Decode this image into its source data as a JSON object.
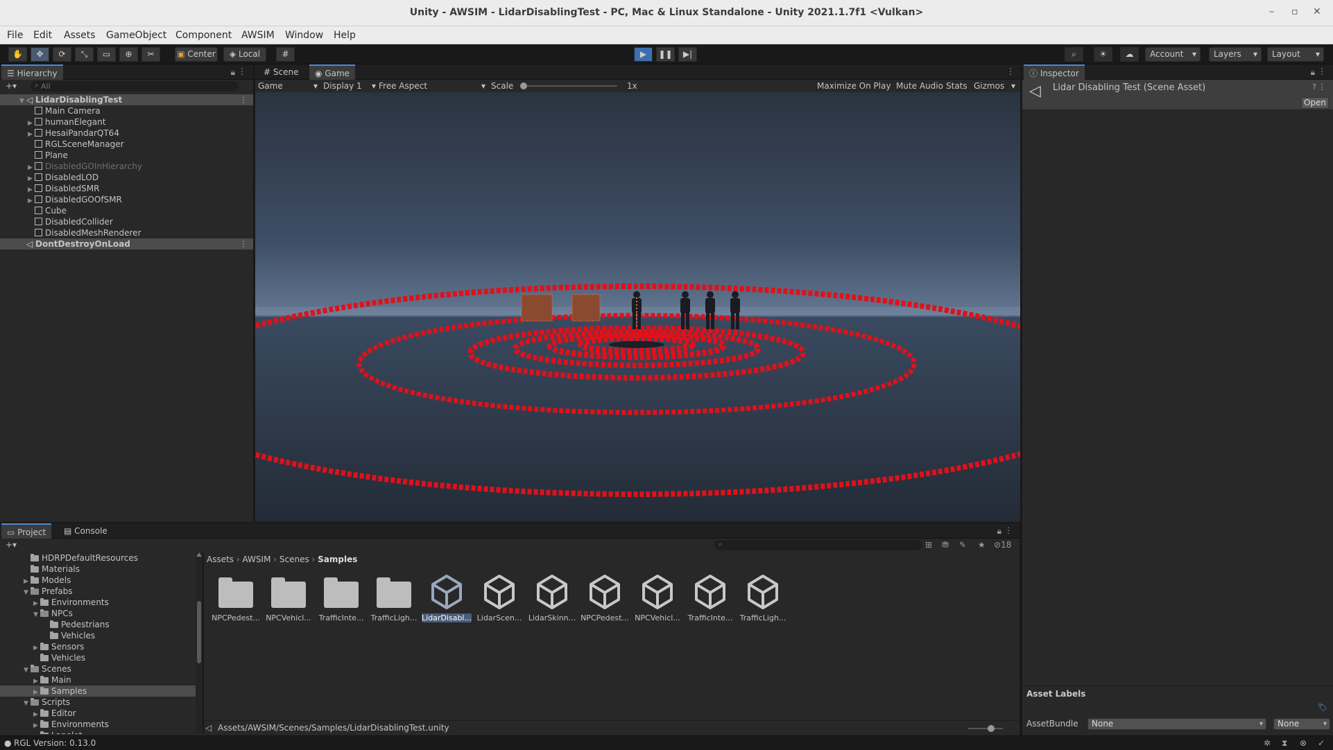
{
  "window": {
    "title": "Unity - AWSIM - LidarDisablingTest - PC, Mac & Linux Standalone - Unity 2021.1.7f1 <Vulkan>",
    "controls": [
      "–",
      "▫",
      "✕"
    ]
  },
  "menu": [
    "File",
    "Edit",
    "Assets",
    "GameObject",
    "Component",
    "AWSIM",
    "Window",
    "Help"
  ],
  "toolbar": {
    "pivot": "Center",
    "space": "Local",
    "account": "Account",
    "layers": "Layers",
    "layout": "Layout"
  },
  "hierarchy": {
    "tab": "Hierarchy",
    "search_placeholder": "All",
    "items": [
      {
        "label": "LidarDisablingTest",
        "depth": 0,
        "expanded": true,
        "kind": "scene",
        "selected": true
      },
      {
        "label": "Main Camera",
        "depth": 1,
        "kind": "go"
      },
      {
        "label": "humanElegant",
        "depth": 1,
        "kind": "go",
        "children": true
      },
      {
        "label": "HesaiPandarQT64",
        "depth": 1,
        "kind": "go",
        "children": true
      },
      {
        "label": "RGLSceneManager",
        "depth": 1,
        "kind": "go"
      },
      {
        "label": "Plane",
        "depth": 1,
        "kind": "go"
      },
      {
        "label": "DisabledGOInHierarchy",
        "depth": 1,
        "kind": "go",
        "children": true,
        "disabled": true
      },
      {
        "label": "DisabledLOD",
        "depth": 1,
        "kind": "go",
        "children": true
      },
      {
        "label": "DisabledSMR",
        "depth": 1,
        "kind": "go",
        "children": true
      },
      {
        "label": "DisabledGOOfSMR",
        "depth": 1,
        "kind": "go",
        "children": true
      },
      {
        "label": "Cube",
        "depth": 1,
        "kind": "go"
      },
      {
        "label": "DisabledCollider",
        "depth": 1,
        "kind": "go"
      },
      {
        "label": "DisabledMeshRenderer",
        "depth": 1,
        "kind": "go"
      },
      {
        "label": "DontDestroyOnLoad",
        "depth": 0,
        "kind": "scene",
        "selected": true
      }
    ]
  },
  "view_tabs": {
    "scene": "Scene",
    "game": "Game"
  },
  "game_toolbar": {
    "mode": "Game",
    "display": "Display 1",
    "aspect": "Free Aspect",
    "scale_label": "Scale",
    "scale_value": "1x",
    "scale_level": 0.0,
    "maximize": "Maximize On Play",
    "mute": "Mute Audio",
    "stats": "Stats",
    "gizmos": "Gizmos"
  },
  "inspector": {
    "tab": "Inspector",
    "title": "Lidar Disabling Test (Scene Asset)",
    "open_button": "Open",
    "asset_labels": "Asset Labels",
    "assetbundle_label": "AssetBundle",
    "assetbundle_value": "None",
    "variant_value": "None"
  },
  "bottom_tabs": {
    "project": "Project",
    "console": "Console"
  },
  "project": {
    "hidden_count": "18",
    "tree": [
      {
        "label": "HDRPDefaultResources",
        "depth": 1
      },
      {
        "label": "Materials",
        "depth": 1
      },
      {
        "label": "Models",
        "depth": 1,
        "children": true
      },
      {
        "label": "Prefabs",
        "depth": 1,
        "expanded": true
      },
      {
        "label": "Environments",
        "depth": 2,
        "children": true
      },
      {
        "label": "NPCs",
        "depth": 2,
        "expanded": true
      },
      {
        "label": "Pedestrians",
        "depth": 3
      },
      {
        "label": "Vehicles",
        "depth": 3
      },
      {
        "label": "Sensors",
        "depth": 2,
        "children": true
      },
      {
        "label": "Vehicles",
        "depth": 2
      },
      {
        "label": "Scenes",
        "depth": 1,
        "expanded": true
      },
      {
        "label": "Main",
        "depth": 2,
        "children": true
      },
      {
        "label": "Samples",
        "depth": 2,
        "children": true,
        "selected": true
      },
      {
        "label": "Scripts",
        "depth": 1,
        "expanded": true
      },
      {
        "label": "Editor",
        "depth": 2,
        "children": true
      },
      {
        "label": "Environments",
        "depth": 2,
        "children": true
      },
      {
        "label": "Lanelet",
        "depth": 2,
        "children": true
      }
    ],
    "breadcrumb": [
      "Assets",
      "AWSIM",
      "Scenes",
      "Samples"
    ],
    "assets": [
      {
        "label": "NPCPedest...",
        "kind": "folder"
      },
      {
        "label": "NPCVehicl...",
        "kind": "folder"
      },
      {
        "label": "TrafficInte...",
        "kind": "folder"
      },
      {
        "label": "TrafficLigh...",
        "kind": "folder"
      },
      {
        "label": "LidarDisabl...",
        "kind": "scene",
        "selected": true
      },
      {
        "label": "LidarScen...",
        "kind": "scene"
      },
      {
        "label": "LidarSkinn...",
        "kind": "scene"
      },
      {
        "label": "NPCPedest...",
        "kind": "scene"
      },
      {
        "label": "NPCVehicl...",
        "kind": "scene"
      },
      {
        "label": "TrafficInte...",
        "kind": "scene"
      },
      {
        "label": "TrafficLigh...",
        "kind": "scene"
      }
    ],
    "path": "Assets/AWSIM/Scenes/Samples/LidarDisablingTest.unity"
  },
  "statusbar": {
    "text": "RGL Version: 0.13.0"
  },
  "colors": {
    "accent": "#4a8bd6",
    "lidar": "#e0111a",
    "panel": "#282828",
    "selection": "#4c4c4c"
  }
}
